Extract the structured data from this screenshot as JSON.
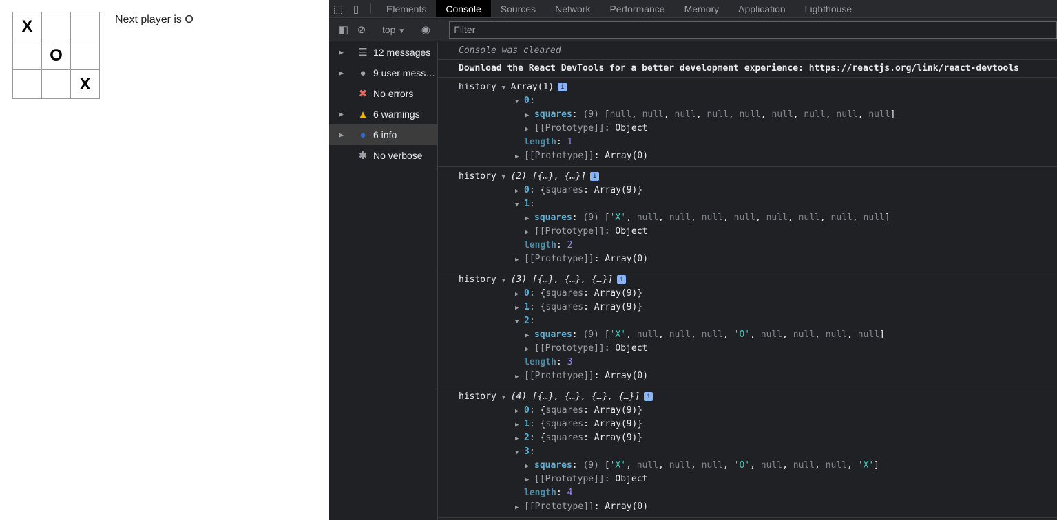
{
  "game": {
    "squares": [
      "X",
      "",
      "",
      "",
      "O",
      "",
      "",
      "",
      "X"
    ],
    "status": "Next player is O"
  },
  "devtools": {
    "tabs": [
      "Elements",
      "Console",
      "Sources",
      "Network",
      "Performance",
      "Memory",
      "Application",
      "Lighthouse"
    ],
    "active_tab": "Console",
    "toolbar": {
      "context": "top",
      "filter_placeholder": "Filter"
    },
    "sidebar": [
      {
        "label": "12 messages",
        "icon": "list-icon",
        "expandable": true
      },
      {
        "label": "9 user mess…",
        "icon": "user-icon",
        "expandable": true
      },
      {
        "label": "No errors",
        "icon": "error-icon",
        "expandable": false
      },
      {
        "label": "6 warnings",
        "icon": "warning-icon",
        "expandable": true
      },
      {
        "label": "6 info",
        "icon": "info-icon",
        "expandable": true,
        "selected": true
      },
      {
        "label": "No verbose",
        "icon": "bug-icon",
        "expandable": false
      }
    ],
    "console": {
      "cleared": "Console was cleared",
      "react_msg": "Download the React DevTools for a better development experience: ",
      "react_link": "https://reactjs.org/link/react-devtools",
      "groups": [
        {
          "label": "history",
          "lines": [
            {
              "depth": 0,
              "arrow": "down",
              "segs": [
                [
                  "Array(1)",
                  "w"
                ]
              ],
              "badge": true
            },
            {
              "depth": 1,
              "arrow": "down",
              "segs": [
                [
                  "0",
                  "k"
                ],
                [
                  ":",
                  "w"
                ]
              ]
            },
            {
              "depth": 2,
              "arrow": "right",
              "segs": [
                [
                  "squares",
                  "k"
                ],
                [
                  ": ",
                  "w"
                ],
                [
                  "(9) ",
                  "g"
                ],
                [
                  "[",
                  "w"
                ],
                [
                  "null",
                  "nl"
                ],
                [
                  ", ",
                  "w"
                ],
                [
                  "null",
                  "nl"
                ],
                [
                  ", ",
                  "w"
                ],
                [
                  "null",
                  "nl"
                ],
                [
                  ", ",
                  "w"
                ],
                [
                  "null",
                  "nl"
                ],
                [
                  ", ",
                  "w"
                ],
                [
                  "null",
                  "nl"
                ],
                [
                  ", ",
                  "w"
                ],
                [
                  "null",
                  "nl"
                ],
                [
                  ", ",
                  "w"
                ],
                [
                  "null",
                  "nl"
                ],
                [
                  ", ",
                  "w"
                ],
                [
                  "null",
                  "nl"
                ],
                [
                  ", ",
                  "w"
                ],
                [
                  "null",
                  "nl"
                ],
                [
                  "]",
                  "w"
                ]
              ]
            },
            {
              "depth": 2,
              "arrow": "right",
              "segs": [
                [
                  "[[Prototype]]",
                  "g"
                ],
                [
                  ": Object",
                  "w"
                ]
              ]
            },
            {
              "depth": 1,
              "arrow": "",
              "segs": [
                [
                  "length",
                  "kd"
                ],
                [
                  ": ",
                  "w"
                ],
                [
                  "1",
                  "n"
                ]
              ]
            },
            {
              "depth": 1,
              "arrow": "right",
              "segs": [
                [
                  "[[Prototype]]",
                  "g"
                ],
                [
                  ": Array(0)",
                  "w"
                ]
              ]
            }
          ]
        },
        {
          "label": "history",
          "lines": [
            {
              "depth": 0,
              "arrow": "down",
              "segs": [
                [
                  "(2) [{…}, {…}]",
                  "i"
                ]
              ],
              "badge": true
            },
            {
              "depth": 1,
              "arrow": "right",
              "segs": [
                [
                  "0",
                  "k"
                ],
                [
                  ": {",
                  "w"
                ],
                [
                  "squares",
                  "g"
                ],
                [
                  ": Array(9)}",
                  "w"
                ]
              ]
            },
            {
              "depth": 1,
              "arrow": "down",
              "segs": [
                [
                  "1",
                  "k"
                ],
                [
                  ":",
                  "w"
                ]
              ]
            },
            {
              "depth": 2,
              "arrow": "right",
              "segs": [
                [
                  "squares",
                  "k"
                ],
                [
                  ": ",
                  "w"
                ],
                [
                  "(9) ",
                  "g"
                ],
                [
                  "[",
                  "w"
                ],
                [
                  "'X'",
                  "s"
                ],
                [
                  ", ",
                  "w"
                ],
                [
                  "null",
                  "nl"
                ],
                [
                  ", ",
                  "w"
                ],
                [
                  "null",
                  "nl"
                ],
                [
                  ", ",
                  "w"
                ],
                [
                  "null",
                  "nl"
                ],
                [
                  ", ",
                  "w"
                ],
                [
                  "null",
                  "nl"
                ],
                [
                  ", ",
                  "w"
                ],
                [
                  "null",
                  "nl"
                ],
                [
                  ", ",
                  "w"
                ],
                [
                  "null",
                  "nl"
                ],
                [
                  ", ",
                  "w"
                ],
                [
                  "null",
                  "nl"
                ],
                [
                  ", ",
                  "w"
                ],
                [
                  "null",
                  "nl"
                ],
                [
                  "]",
                  "w"
                ]
              ]
            },
            {
              "depth": 2,
              "arrow": "right",
              "segs": [
                [
                  "[[Prototype]]",
                  "g"
                ],
                [
                  ": Object",
                  "w"
                ]
              ]
            },
            {
              "depth": 1,
              "arrow": "",
              "segs": [
                [
                  "length",
                  "kd"
                ],
                [
                  ": ",
                  "w"
                ],
                [
                  "2",
                  "n"
                ]
              ]
            },
            {
              "depth": 1,
              "arrow": "right",
              "segs": [
                [
                  "[[Prototype]]",
                  "g"
                ],
                [
                  ": Array(0)",
                  "w"
                ]
              ]
            }
          ]
        },
        {
          "label": "history",
          "lines": [
            {
              "depth": 0,
              "arrow": "down",
              "segs": [
                [
                  "(3) [{…}, {…}, {…}]",
                  "i"
                ]
              ],
              "badge": true
            },
            {
              "depth": 1,
              "arrow": "right",
              "segs": [
                [
                  "0",
                  "k"
                ],
                [
                  ": {",
                  "w"
                ],
                [
                  "squares",
                  "g"
                ],
                [
                  ": Array(9)}",
                  "w"
                ]
              ]
            },
            {
              "depth": 1,
              "arrow": "right",
              "segs": [
                [
                  "1",
                  "k"
                ],
                [
                  ": {",
                  "w"
                ],
                [
                  "squares",
                  "g"
                ],
                [
                  ": Array(9)}",
                  "w"
                ]
              ]
            },
            {
              "depth": 1,
              "arrow": "down",
              "segs": [
                [
                  "2",
                  "k"
                ],
                [
                  ":",
                  "w"
                ]
              ]
            },
            {
              "depth": 2,
              "arrow": "right",
              "segs": [
                [
                  "squares",
                  "k"
                ],
                [
                  ": ",
                  "w"
                ],
                [
                  "(9) ",
                  "g"
                ],
                [
                  "[",
                  "w"
                ],
                [
                  "'X'",
                  "s"
                ],
                [
                  ", ",
                  "w"
                ],
                [
                  "null",
                  "nl"
                ],
                [
                  ", ",
                  "w"
                ],
                [
                  "null",
                  "nl"
                ],
                [
                  ", ",
                  "w"
                ],
                [
                  "null",
                  "nl"
                ],
                [
                  ", ",
                  "w"
                ],
                [
                  "'O'",
                  "s"
                ],
                [
                  ", ",
                  "w"
                ],
                [
                  "null",
                  "nl"
                ],
                [
                  ", ",
                  "w"
                ],
                [
                  "null",
                  "nl"
                ],
                [
                  ", ",
                  "w"
                ],
                [
                  "null",
                  "nl"
                ],
                [
                  ", ",
                  "w"
                ],
                [
                  "null",
                  "nl"
                ],
                [
                  "]",
                  "w"
                ]
              ]
            },
            {
              "depth": 2,
              "arrow": "right",
              "segs": [
                [
                  "[[Prototype]]",
                  "g"
                ],
                [
                  ": Object",
                  "w"
                ]
              ]
            },
            {
              "depth": 1,
              "arrow": "",
              "segs": [
                [
                  "length",
                  "kd"
                ],
                [
                  ": ",
                  "w"
                ],
                [
                  "3",
                  "n"
                ]
              ]
            },
            {
              "depth": 1,
              "arrow": "right",
              "segs": [
                [
                  "[[Prototype]]",
                  "g"
                ],
                [
                  ": Array(0)",
                  "w"
                ]
              ]
            }
          ]
        },
        {
          "label": "history",
          "lines": [
            {
              "depth": 0,
              "arrow": "down",
              "segs": [
                [
                  "(4) [{…}, {…}, {…}, {…}]",
                  "i"
                ]
              ],
              "badge": true
            },
            {
              "depth": 1,
              "arrow": "right",
              "segs": [
                [
                  "0",
                  "k"
                ],
                [
                  ": {",
                  "w"
                ],
                [
                  "squares",
                  "g"
                ],
                [
                  ": Array(9)}",
                  "w"
                ]
              ]
            },
            {
              "depth": 1,
              "arrow": "right",
              "segs": [
                [
                  "1",
                  "k"
                ],
                [
                  ": {",
                  "w"
                ],
                [
                  "squares",
                  "g"
                ],
                [
                  ": Array(9)}",
                  "w"
                ]
              ]
            },
            {
              "depth": 1,
              "arrow": "right",
              "segs": [
                [
                  "2",
                  "k"
                ],
                [
                  ": {",
                  "w"
                ],
                [
                  "squares",
                  "g"
                ],
                [
                  ": Array(9)}",
                  "w"
                ]
              ]
            },
            {
              "depth": 1,
              "arrow": "down",
              "segs": [
                [
                  "3",
                  "k"
                ],
                [
                  ":",
                  "w"
                ]
              ]
            },
            {
              "depth": 2,
              "arrow": "right",
              "segs": [
                [
                  "squares",
                  "k"
                ],
                [
                  ": ",
                  "w"
                ],
                [
                  "(9) ",
                  "g"
                ],
                [
                  "[",
                  "w"
                ],
                [
                  "'X'",
                  "s"
                ],
                [
                  ", ",
                  "w"
                ],
                [
                  "null",
                  "nl"
                ],
                [
                  ", ",
                  "w"
                ],
                [
                  "null",
                  "nl"
                ],
                [
                  ", ",
                  "w"
                ],
                [
                  "null",
                  "nl"
                ],
                [
                  ", ",
                  "w"
                ],
                [
                  "'O'",
                  "s"
                ],
                [
                  ", ",
                  "w"
                ],
                [
                  "null",
                  "nl"
                ],
                [
                  ", ",
                  "w"
                ],
                [
                  "null",
                  "nl"
                ],
                [
                  ", ",
                  "w"
                ],
                [
                  "null",
                  "nl"
                ],
                [
                  ", ",
                  "w"
                ],
                [
                  "'X'",
                  "s"
                ],
                [
                  "]",
                  "w"
                ]
              ]
            },
            {
              "depth": 2,
              "arrow": "right",
              "segs": [
                [
                  "[[Prototype]]",
                  "g"
                ],
                [
                  ": Object",
                  "w"
                ]
              ]
            },
            {
              "depth": 1,
              "arrow": "",
              "segs": [
                [
                  "length",
                  "kd"
                ],
                [
                  ": ",
                  "w"
                ],
                [
                  "4",
                  "n"
                ]
              ]
            },
            {
              "depth": 1,
              "arrow": "right",
              "segs": [
                [
                  "[[Prototype]]",
                  "g"
                ],
                [
                  ": Array(0)",
                  "w"
                ]
              ]
            }
          ]
        }
      ],
      "prompt": "›"
    }
  }
}
